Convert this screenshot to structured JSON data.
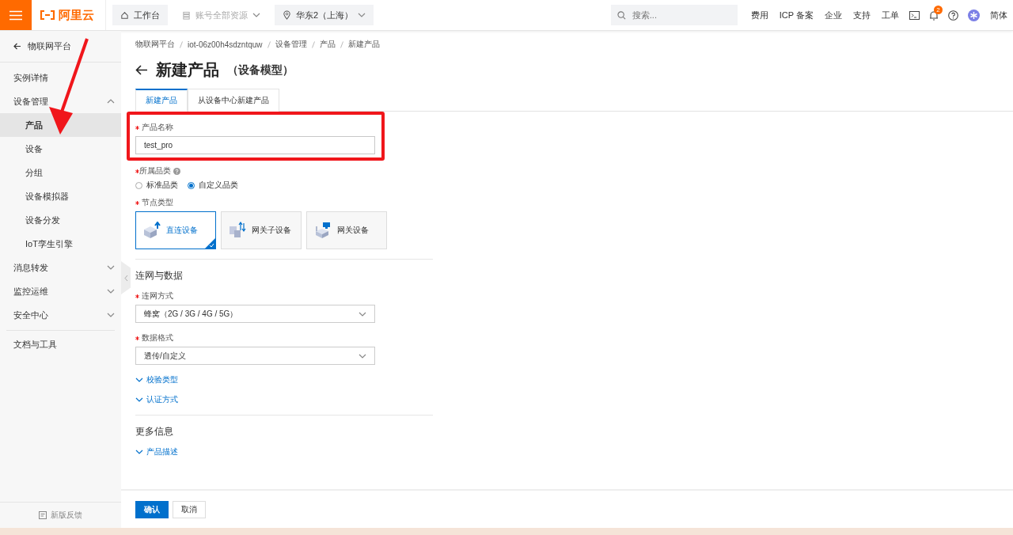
{
  "top_bar": {
    "logo": "阿里云",
    "nav": [
      {
        "label": "工作台",
        "kind": "home",
        "disabled": false
      },
      {
        "label": "账号全部资源",
        "kind": "resources",
        "disabled": true
      },
      {
        "label": "华东2（上海）",
        "kind": "region",
        "disabled": false
      }
    ],
    "search": {
      "placeholder": "搜索..."
    },
    "links": [
      "费用",
      "ICP 备案",
      "企业",
      "支持",
      "工单"
    ],
    "notification_count": "2",
    "language": "简体"
  },
  "sidebar": {
    "back": "物联网平台",
    "items": [
      {
        "label": "实例详情",
        "kind": "link"
      },
      {
        "label": "设备管理",
        "kind": "group",
        "expanded": true,
        "children": [
          {
            "label": "产品",
            "selected": true
          },
          {
            "label": "设备",
            "selected": false
          },
          {
            "label": "分组",
            "selected": false
          },
          {
            "label": "设备模拟器",
            "selected": false
          },
          {
            "label": "设备分发",
            "selected": false
          },
          {
            "label": "IoT孪生引擎",
            "selected": false
          }
        ]
      },
      {
        "label": "消息转发",
        "kind": "group",
        "expanded": false
      },
      {
        "label": "监控运维",
        "kind": "group",
        "expanded": false
      },
      {
        "label": "安全中心",
        "kind": "group",
        "expanded": false
      }
    ],
    "docs": "文档与工具",
    "feedback": "新版反馈"
  },
  "breadcrumb": [
    "物联网平台",
    "iot-06z00h4sdzntquw",
    "设备管理",
    "产品",
    "新建产品"
  ],
  "title": "新建产品",
  "subtitle": "（设备模型）",
  "tabs": [
    {
      "label": "新建产品",
      "selected": true
    },
    {
      "label": "从设备中心新建产品",
      "selected": false
    }
  ],
  "form": {
    "product_name": {
      "label": "产品名称",
      "required": true,
      "value": "test_pro"
    },
    "category": {
      "label": "所属品类",
      "required": true,
      "options": [
        {
          "label": "标准品类",
          "selected": false
        },
        {
          "label": "自定义品类",
          "selected": true
        }
      ]
    },
    "node_type": {
      "label": "节点类型",
      "required": true,
      "options": [
        {
          "label": "直连设备",
          "kind": "direct",
          "selected": true
        },
        {
          "label": "网关子设备",
          "kind": "sub",
          "selected": false
        },
        {
          "label": "网关设备",
          "kind": "gateway",
          "selected": false
        }
      ]
    }
  },
  "sections": [
    {
      "title": "连网与数据",
      "selects": [
        {
          "label": "连网方式",
          "required": true,
          "value": "蜂窝（2G / 3G / 4G / 5G）"
        },
        {
          "label": "数据格式",
          "required": true,
          "value": "透传/自定义"
        }
      ],
      "expanders": [
        "校验类型",
        "认证方式"
      ]
    },
    {
      "title": "更多信息",
      "expanders": [
        "产品描述"
      ]
    }
  ],
  "actions": [
    {
      "label": "确认",
      "kind": "primary"
    },
    {
      "label": "取消",
      "kind": "default"
    }
  ]
}
